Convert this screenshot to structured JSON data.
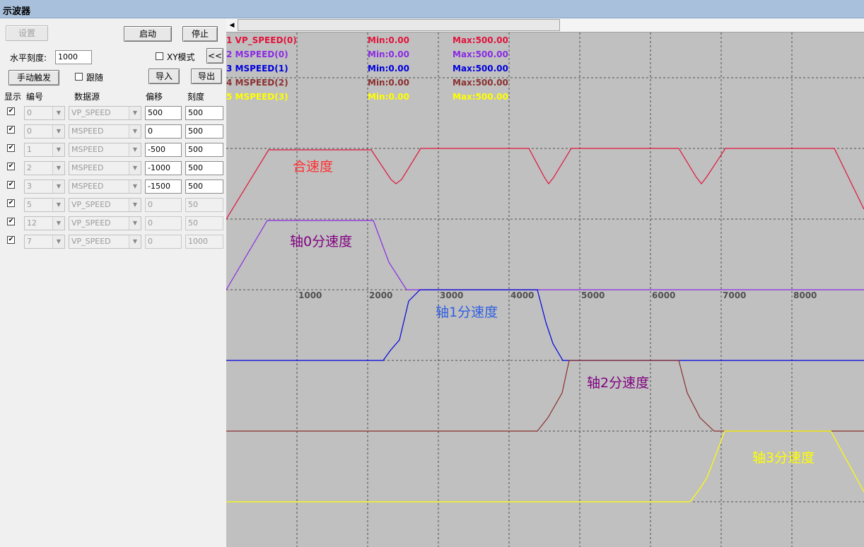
{
  "window": {
    "title": "示波器"
  },
  "controls": {
    "setup_label": "设置",
    "start_label": "启动",
    "stop_label": "停止",
    "hscale_label": "水平刻度:",
    "hscale_value": "1000",
    "xy_mode_label": "XY模式",
    "collapse_label": "<<",
    "manual_trigger_label": "手动触发",
    "follow_label": "跟随",
    "import_label": "导入",
    "export_label": "导出"
  },
  "table": {
    "headers": {
      "show": "显示",
      "number": "编号",
      "source": "数据源",
      "offset": "偏移",
      "scale": "刻度"
    },
    "rows": [
      {
        "checked": true,
        "number": "0",
        "source": "VP_SPEED",
        "offset": "500",
        "scale": "500",
        "enabled": true
      },
      {
        "checked": true,
        "number": "0",
        "source": "MSPEED",
        "offset": "0",
        "scale": "500",
        "enabled": true
      },
      {
        "checked": true,
        "number": "1",
        "source": "MSPEED",
        "offset": "-500",
        "scale": "500",
        "enabled": true
      },
      {
        "checked": true,
        "number": "2",
        "source": "MSPEED",
        "offset": "-1000",
        "scale": "500",
        "enabled": true
      },
      {
        "checked": true,
        "number": "3",
        "source": "MSPEED",
        "offset": "-1500",
        "scale": "500",
        "enabled": true
      },
      {
        "checked": true,
        "number": "5",
        "source": "VP_SPEED",
        "offset": "0",
        "scale": "50",
        "enabled": false
      },
      {
        "checked": true,
        "number": "12",
        "source": "VP_SPEED",
        "offset": "0",
        "scale": "50",
        "enabled": false
      },
      {
        "checked": true,
        "number": "7",
        "source": "VP_SPEED",
        "offset": "0",
        "scale": "1000",
        "enabled": false
      }
    ]
  },
  "scope": {
    "legend": [
      {
        "name": "1 VP_SPEED(0)",
        "min": "Min:0.00",
        "max": "Max:500.00",
        "color": "#e0143c"
      },
      {
        "name": "2 MSPEED(0)",
        "min": "Min:0.00",
        "max": "Max:500.00",
        "color": "#8a2be2"
      },
      {
        "name": "3 MSPEED(1)",
        "min": "Min:0.00",
        "max": "Max:500.00",
        "color": "#0000dc"
      },
      {
        "name": "4 MSPEED(2)",
        "min": "Min:0.00",
        "max": "Max:500.00",
        "color": "#8b3030"
      },
      {
        "name": "5 MSPEED(3)",
        "min": "Min:0.00",
        "max": "Max:500.00",
        "color": "#ffff00"
      }
    ],
    "x_ticks": [
      "1000",
      "2000",
      "3000",
      "4000",
      "5000",
      "6000",
      "7000",
      "8000"
    ],
    "annotations": [
      {
        "text": "合速度",
        "color": "#ff3030"
      },
      {
        "text": "轴0分速度",
        "color": "#800080"
      },
      {
        "text": "轴1分速度",
        "color": "#3060e0"
      },
      {
        "text": "轴2分速度",
        "color": "#800080"
      },
      {
        "text": "轴3分速度",
        "color": "#ffff00"
      }
    ],
    "colors": {
      "background": "#c0c0c0",
      "grid": "#505050"
    }
  }
}
